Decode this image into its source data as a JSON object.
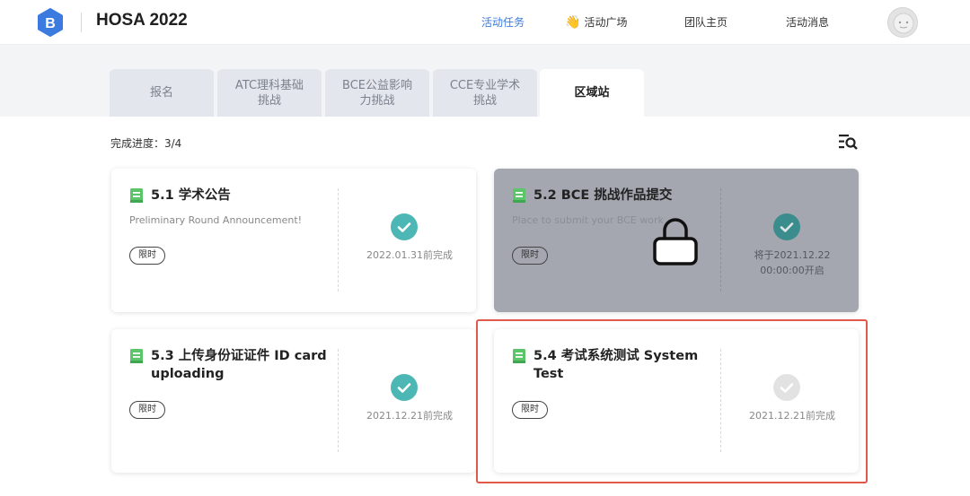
{
  "header": {
    "title": "HOSA 2022",
    "nav": [
      {
        "label": "活动任务",
        "active": true
      },
      {
        "label": "活动广场",
        "icon": "waving-hand-icon"
      },
      {
        "label": "团队主页"
      },
      {
        "label": "活动消息"
      }
    ],
    "accent_color": "#3b7be0"
  },
  "tabs": [
    {
      "label": "报名"
    },
    {
      "label": "ATC理科基础挑战"
    },
    {
      "label": "BCE公益影响力挑战"
    },
    {
      "label": "CCE专业学术挑战"
    },
    {
      "label": "区域站",
      "active": true
    }
  ],
  "progress": {
    "label": "完成进度：3/4"
  },
  "cards": [
    {
      "title": "5.1 学术公告",
      "desc": "Preliminary Round Announcement!",
      "badge": "限时",
      "due": "2022.01.31前完成",
      "status": "completed"
    },
    {
      "title": "5.2 BCE 挑战作品提交",
      "desc": "Place to submit your BCE work",
      "badge": "限时",
      "due": "将于2021.12.22 00:00:00开启",
      "status": "locked"
    },
    {
      "title": "5.3 上传身份证证件 ID card uploading",
      "desc": "",
      "badge": "限时",
      "due": "2021.12.21前完成",
      "status": "completed"
    },
    {
      "title": "5.4 考试系统测试 System Test",
      "desc": "",
      "badge": "限时",
      "due": "2021.12.21前完成",
      "status": "pending"
    }
  ],
  "colors": {
    "check_done": "#4cb7b4",
    "check_pending": "#e2e2e2",
    "highlight": "#e05a4b",
    "book_icon": "#5cc56a"
  }
}
